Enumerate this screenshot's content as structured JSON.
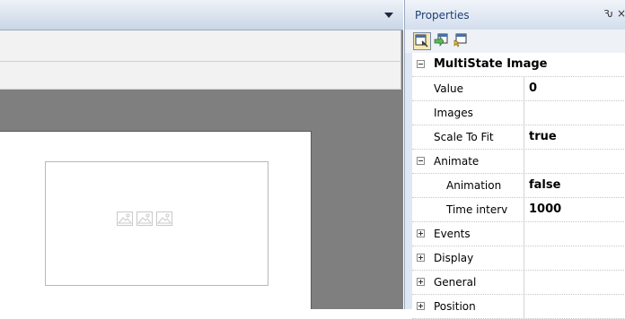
{
  "properties_panel": {
    "title": "Properties",
    "pin_glyph": "Ԅ",
    "close_glyph": "×",
    "toolbar": [
      {
        "icon": "properties-view-icon",
        "active": true
      },
      {
        "icon": "events-view-icon",
        "active": false
      },
      {
        "icon": "object-browser-icon",
        "active": false
      }
    ],
    "rows": [
      {
        "type": "category",
        "label": "MultiState Image",
        "expanded": true
      },
      {
        "type": "property",
        "label": "Value",
        "value": "0"
      },
      {
        "type": "property",
        "label": "Images",
        "value": ""
      },
      {
        "type": "property",
        "label": "Scale To Fit",
        "value": "true"
      },
      {
        "type": "group",
        "label": "Animate",
        "expanded": true
      },
      {
        "type": "subproperty",
        "label": "Animation",
        "value": "false"
      },
      {
        "type": "subproperty",
        "label": "Time interv",
        "value": "1000"
      },
      {
        "type": "group",
        "label": "Events",
        "expanded": false
      },
      {
        "type": "group",
        "label": "Display",
        "expanded": false
      },
      {
        "type": "group",
        "label": "General",
        "expanded": false
      },
      {
        "type": "group",
        "label": "Position",
        "expanded": false
      }
    ]
  },
  "canvas": {
    "widget_icons": [
      "image-placeholder-icon",
      "image-placeholder-icon",
      "image-placeholder-icon"
    ]
  }
}
